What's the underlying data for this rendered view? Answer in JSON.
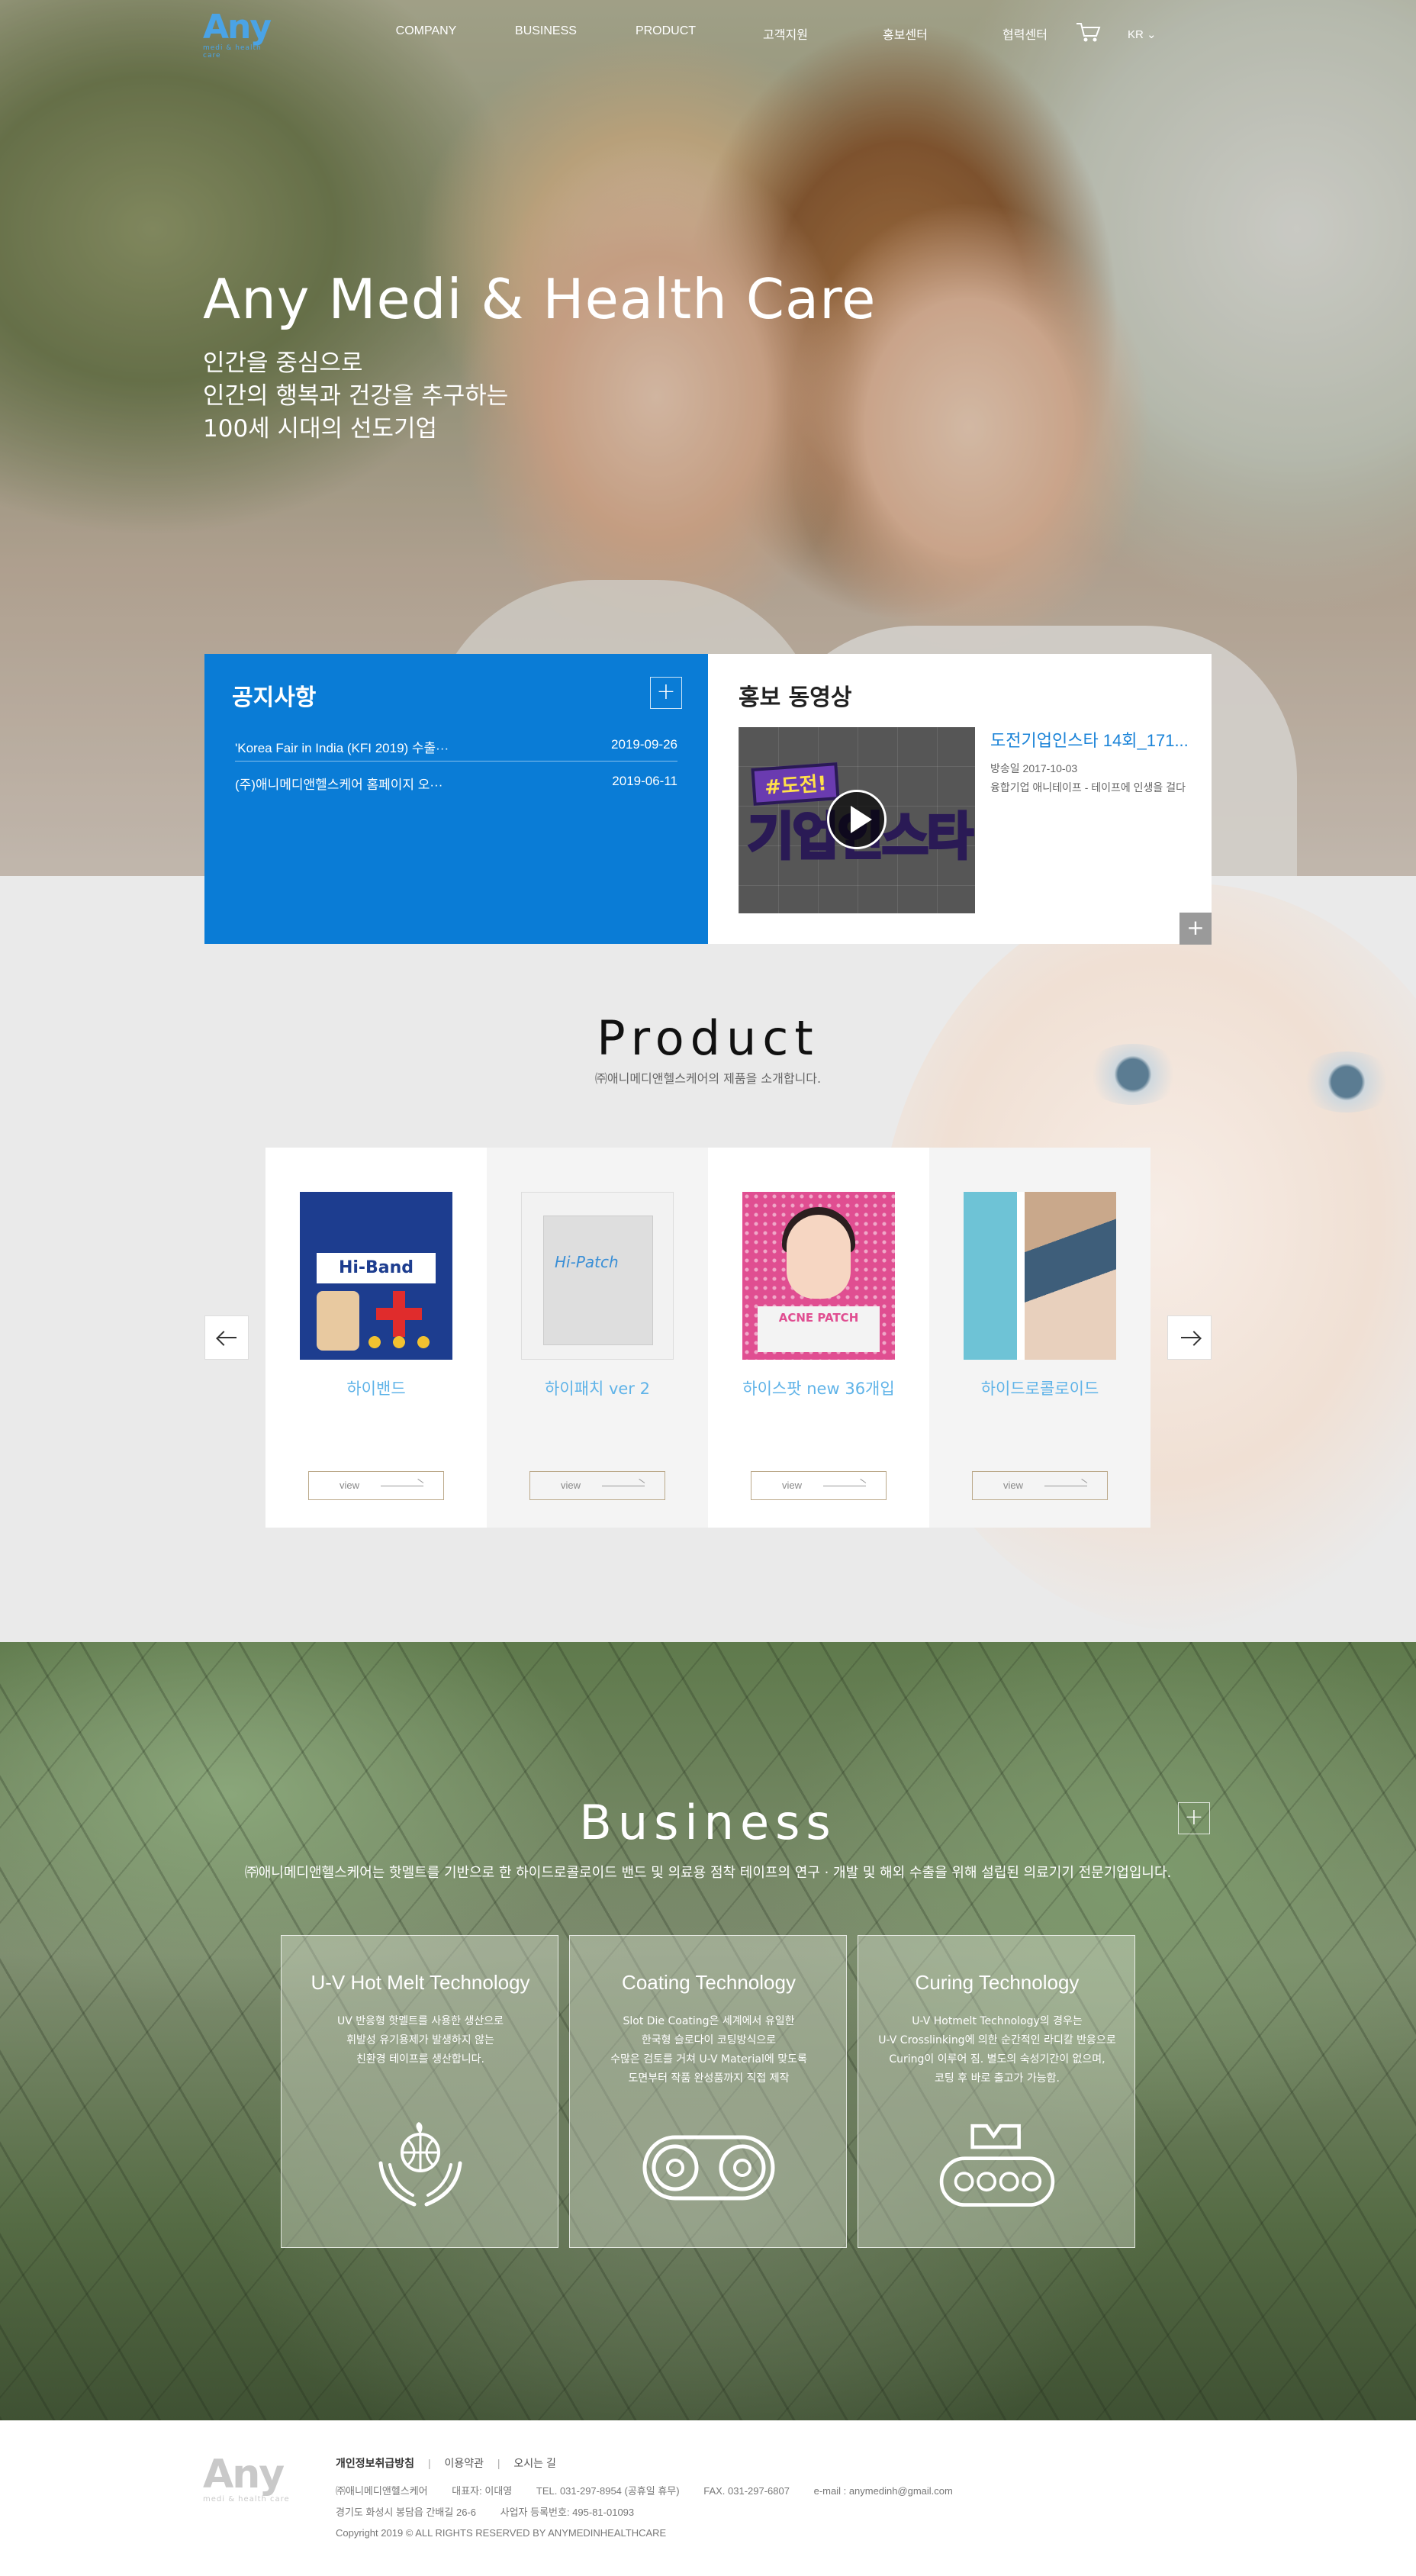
{
  "header": {
    "logo_word": "Any",
    "logo_sub": "medi & health care",
    "nav": [
      "COMPANY",
      "BUSINESS",
      "PRODUCT",
      "고객지원",
      "홍보센터",
      "협력센터"
    ],
    "lang": "KR ⌄"
  },
  "hero": {
    "title": "Any Medi & Health Care",
    "lines": [
      "인간을 중심으로",
      "인간의 행복과 건강을 추구하는",
      "100세 시대의 선도기업"
    ]
  },
  "notice": {
    "title": "공지사항",
    "more": "+",
    "items": [
      {
        "title": "'Korea Fair in India (KFI 2019) 수출···",
        "date": "2019-09-26"
      },
      {
        "title": "(주)애니메디앤헬스케어 홈페이지 오···",
        "date": "2019-06-11"
      }
    ]
  },
  "video": {
    "title": "홍보 동영상",
    "thumb_tag": "#도전!",
    "thumb_text": "기업인스타",
    "item_title": "도전기업인스타 14회_171...",
    "meta": [
      "방송일 2017-10-03",
      "융합기업 애니테이프 - 테이프에 인생을 걸다"
    ],
    "more": "+"
  },
  "product": {
    "title": "Product",
    "subtitle": "㈜애니메디앤헬스케어의 제품을 소개합니다.",
    "items": [
      {
        "name": "하이밴드",
        "view": "view",
        "img_text": "Hi-Band"
      },
      {
        "name": "하이패치 ver 2",
        "view": "view",
        "img_text": "Hi-Patch"
      },
      {
        "name": "하이스팟 new 36개입",
        "view": "view",
        "img_text": "ACNE PATCH"
      },
      {
        "name": "하이드로콜로이드",
        "view": "view",
        "img_text": ""
      }
    ]
  },
  "business": {
    "title": "Business",
    "subtitle": "㈜애니메디앤헬스케어는 핫멜트를 기반으로 한 하이드로콜로이드 밴드 및 의료용 점착 테이프의 연구 · 개발 및 해외 수출을 위해 설립된 의료기기 전문기업입니다.",
    "more": "+",
    "techs": [
      {
        "title": "U-V Hot Melt Technology",
        "lines": [
          "UV 반응형 핫멜트를 사용한 생산으로",
          "휘발성 유기용제가 발생하지 않는",
          "친환경 테이프를 생산합니다."
        ],
        "icon": "globe-hands-icon"
      },
      {
        "title": "Coating Technology",
        "lines": [
          "Slot Die Coating은 세계에서 유일한",
          "한국형 슬로다이 코팅방식으로",
          "수많은 검토를 거쳐 U-V Material에 맞도록",
          "도면부터 작품 완성품까지 직접 제작"
        ],
        "icon": "roller-icon"
      },
      {
        "title": "Curing Technology",
        "lines": [
          "U-V Hotmelt Technology의 경우는",
          "U-V Crosslinking에 의한 순간적인 라디칼 반응으로",
          "Curing이 이루어 짐. 별도의 숙성기간이 없으며,",
          "코팅 후 바로 출고가 가능함."
        ],
        "icon": "conveyor-icon"
      }
    ]
  },
  "footer": {
    "logo_word": "Any",
    "logo_sub": "medi & health care",
    "links": [
      "개인정보취급방침",
      "이용약관",
      "오시는 길"
    ],
    "info1": [
      "㈜애니메디앤헬스케어",
      "대표자: 이대영",
      "TEL. 031-297-8954 (공휴일 휴무)",
      "FAX. 031-297-6807",
      "e-mail : anymedinh@gmail.com"
    ],
    "info2": [
      "경기도 화성시 봉담읍 간배길 26-6",
      "사업자 등록번호: 495-81-01093"
    ],
    "copyright": "Copyright 2019 © ALL RIGHTS RESERVED BY ANYMEDINHEALTHCARE"
  }
}
